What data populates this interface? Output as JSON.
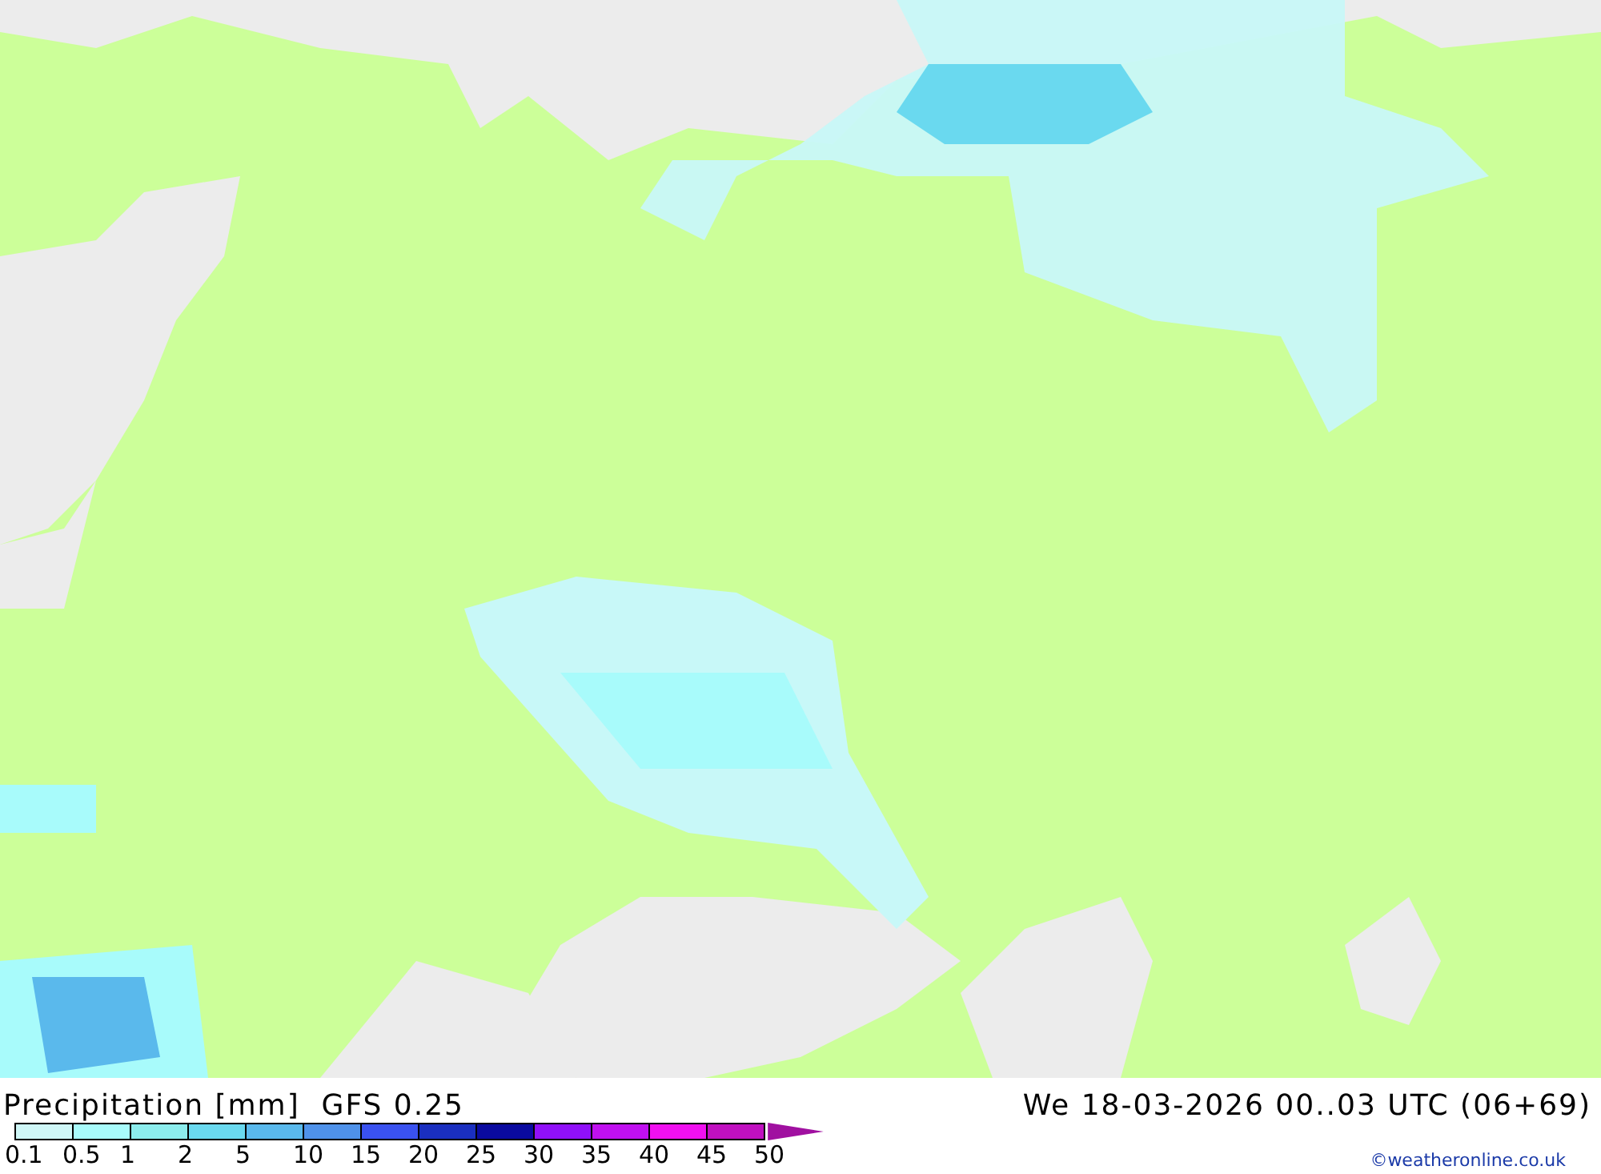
{
  "map": {
    "title": "Precipitation [mm]  GFS 0.25",
    "valid_time": "We 18-03-2026 00..03 UTC (06+69)",
    "credit": "©weatheronline.co.uk"
  },
  "legend": {
    "bins": [
      {
        "label": "0.1",
        "color": "#cff7f7"
      },
      {
        "label": "0.5",
        "color": "#a8fbfb"
      },
      {
        "label": "1",
        "color": "#8ceded"
      },
      {
        "label": "2",
        "color": "#6ad9ef"
      },
      {
        "label": "5",
        "color": "#5ab9ec"
      },
      {
        "label": "10",
        "color": "#4f92ea"
      },
      {
        "label": "15",
        "color": "#3a52f0"
      },
      {
        "label": "20",
        "color": "#1a2fc0"
      },
      {
        "label": "25",
        "color": "#0a0aa0"
      },
      {
        "label": "30",
        "color": "#9010f8"
      },
      {
        "label": "35",
        "color": "#c010f0"
      },
      {
        "label": "40",
        "color": "#f010f0"
      },
      {
        "label": "45",
        "color": "#c010c0"
      },
      {
        "label": "50",
        "color": "#a010a0"
      }
    ]
  }
}
